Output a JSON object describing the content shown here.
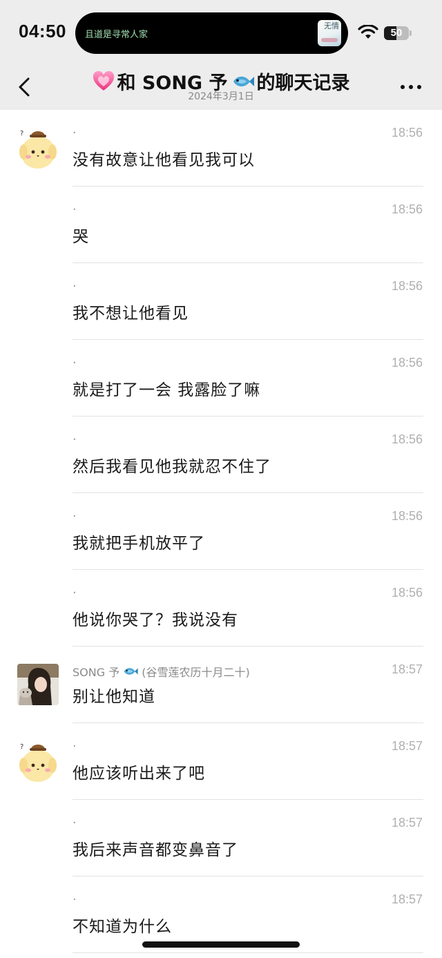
{
  "status_bar": {
    "time": "04:50",
    "island_text": "且道是寻常人家",
    "island_thumb_text": "无情",
    "battery_level": "50",
    "battery_fraction": 0.5
  },
  "nav": {
    "title_prefix": "和 SONG 予",
    "title_suffix": "的聊天记录",
    "date": "2024年3月1日",
    "heart_icon": "heart-icon",
    "fish_icon": "fish-icon"
  },
  "messages": [
    {
      "sender": "me",
      "show_avatar": true,
      "name": ".",
      "time": "18:56",
      "text": "没有故意让他看见我可以"
    },
    {
      "sender": "me",
      "show_avatar": false,
      "name": ".",
      "time": "18:56",
      "text": "哭"
    },
    {
      "sender": "me",
      "show_avatar": false,
      "name": ".",
      "time": "18:56",
      "text": "我不想让他看见"
    },
    {
      "sender": "me",
      "show_avatar": false,
      "name": ".",
      "time": "18:56",
      "text": "就是打了一会 我露脸了嘛"
    },
    {
      "sender": "me",
      "show_avatar": false,
      "name": ".",
      "time": "18:56",
      "text": "然后我看见他我就忍不住了"
    },
    {
      "sender": "me",
      "show_avatar": false,
      "name": ".",
      "time": "18:56",
      "text": "我就把手机放平了"
    },
    {
      "sender": "me",
      "show_avatar": false,
      "name": ".",
      "time": "18:56",
      "text": "他说你哭了？我说没有"
    },
    {
      "sender": "other",
      "show_avatar": true,
      "name": "SONG 予",
      "name_note": "(谷雪莲农历十月二十)",
      "time": "18:57",
      "text": "别让他知道"
    },
    {
      "sender": "me",
      "show_avatar": true,
      "name": ".",
      "time": "18:57",
      "text": "他应该听出来了吧"
    },
    {
      "sender": "me",
      "show_avatar": false,
      "name": ".",
      "time": "18:57",
      "text": "我后来声音都变鼻音了"
    },
    {
      "sender": "me",
      "show_avatar": false,
      "name": ".",
      "time": "18:57",
      "text": "不知道为什么"
    }
  ]
}
